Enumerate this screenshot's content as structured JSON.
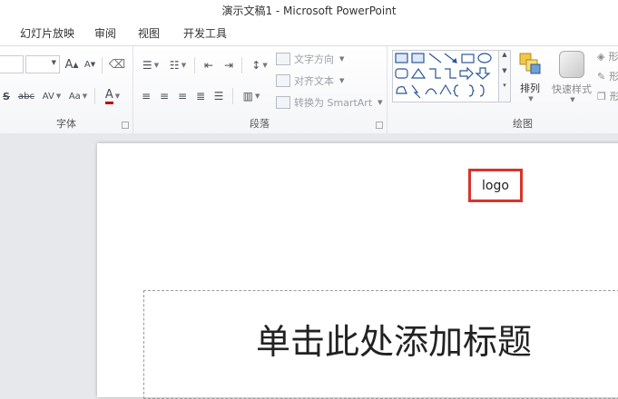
{
  "window": {
    "title": "演示文稿1 - Microsoft PowerPoint"
  },
  "tabs": [
    "幻灯片放映",
    "审阅",
    "视图",
    "开发工具"
  ],
  "ribbon": {
    "font_group": {
      "label": "字体",
      "grow_label": "A",
      "shrink_label": "A",
      "strike_label": "S",
      "abc_label": "abc",
      "spacing_label": "AV",
      "case_label": "Aa",
      "color_label": "A"
    },
    "paragraph_group": {
      "label": "段落",
      "text_direction": "文字方向",
      "align_text": "对齐文本",
      "convert_smartart": "转换为 SmartArt"
    },
    "drawing_group": {
      "label": "绘图",
      "arrange": "排列",
      "quick_styles": "快速样式",
      "side_labels": [
        "形",
        "形",
        "形"
      ]
    }
  },
  "slide": {
    "logo_text": "logo",
    "title_placeholder": "单击此处添加标题"
  },
  "colors": {
    "highlight_border": "#d9342b",
    "ribbon_bg": "#f4f5f7",
    "workspace_bg": "#e6e8eb"
  }
}
